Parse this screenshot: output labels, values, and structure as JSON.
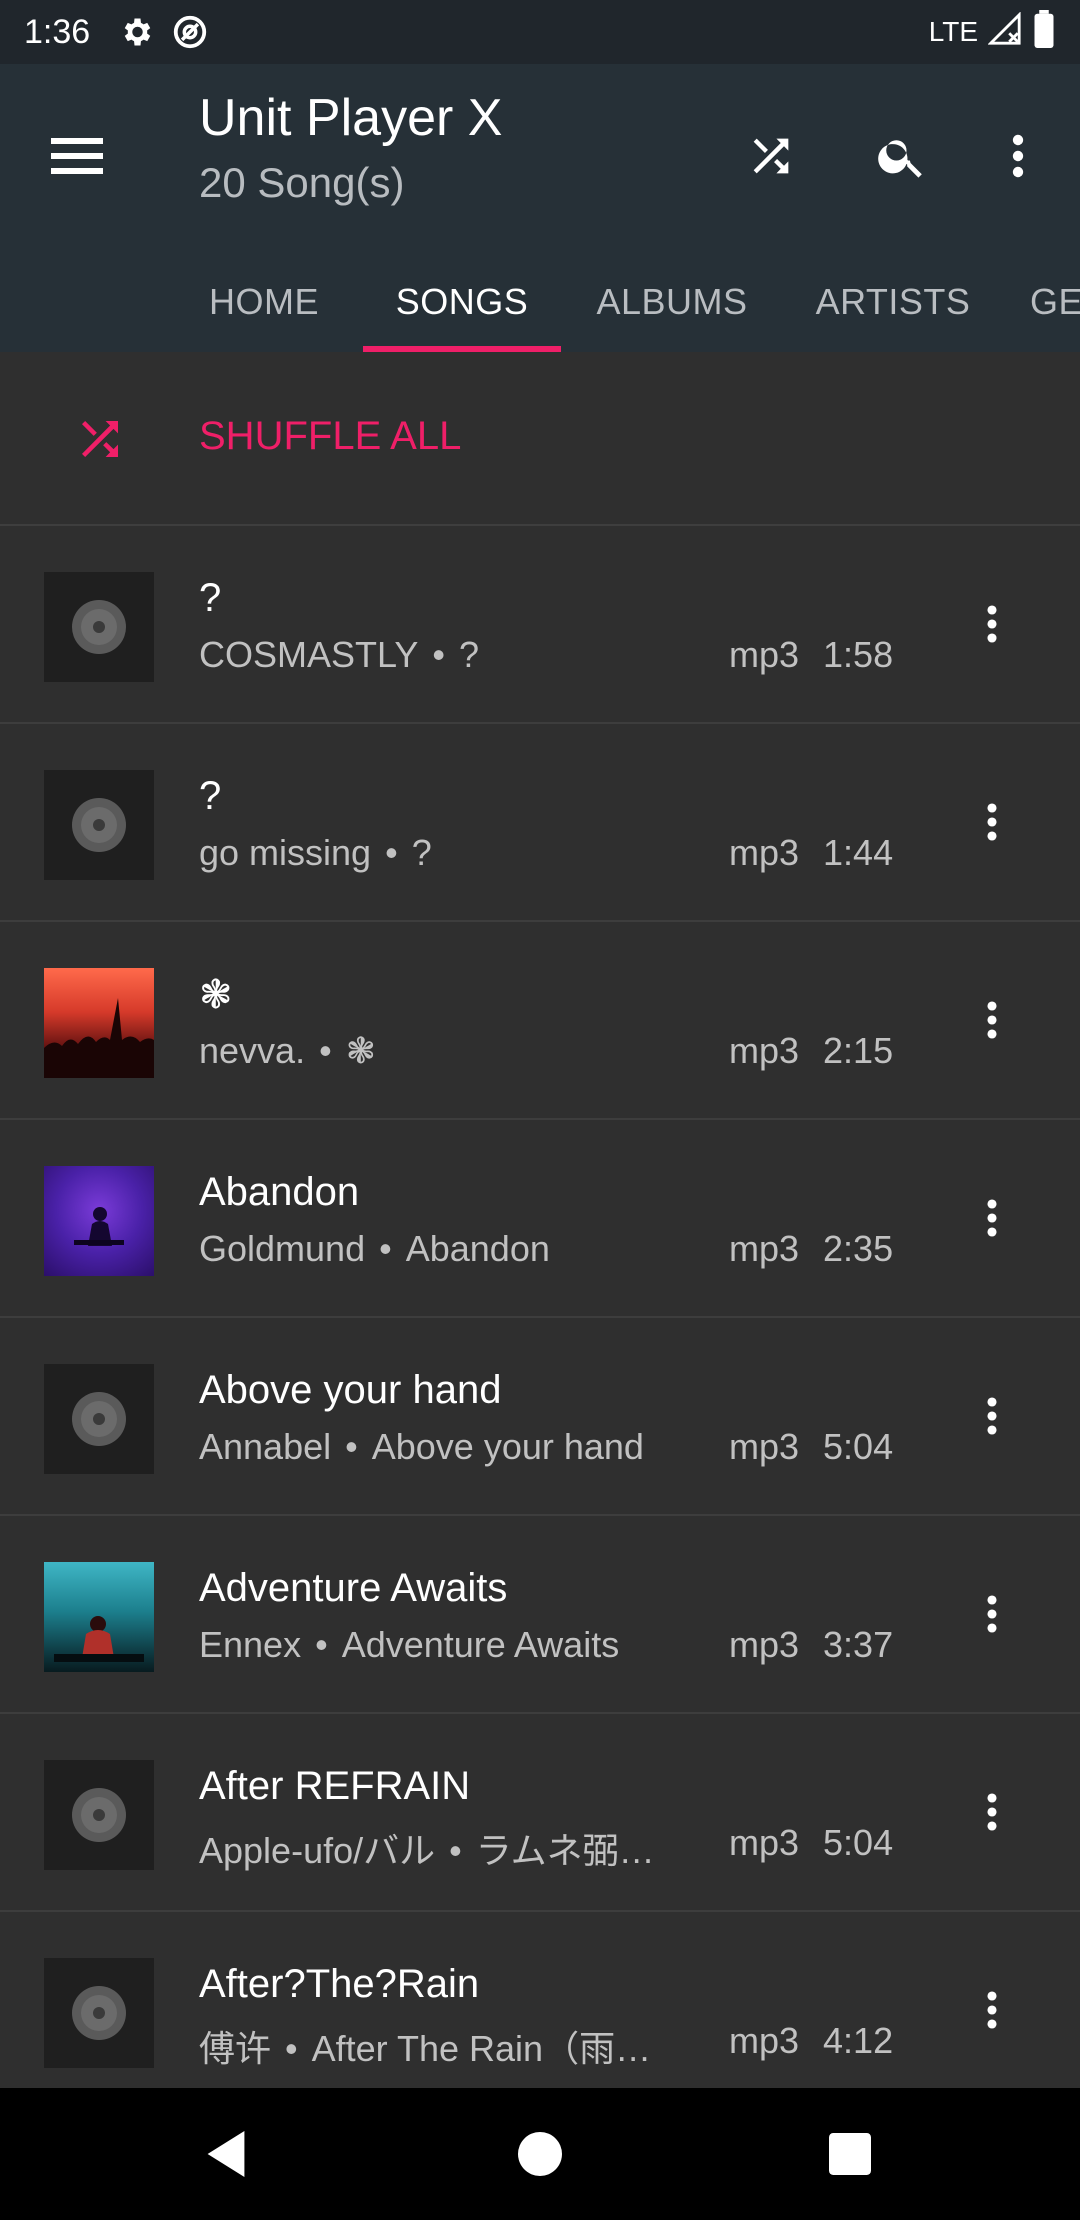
{
  "status_bar": {
    "time": "1:36",
    "network": "LTE",
    "icons": [
      "settings-icon",
      "no-disturb-icon",
      "signal-icon",
      "battery-icon"
    ]
  },
  "app_bar": {
    "title": "Unit Player X",
    "subtitle": "20 Song(s)",
    "actions": [
      "shuffle-icon",
      "search-icon",
      "more-vert-icon"
    ]
  },
  "tabs": [
    {
      "label": "HOME",
      "active": false
    },
    {
      "label": "SONGS",
      "active": true
    },
    {
      "label": "ALBUMS",
      "active": false
    },
    {
      "label": "ARTISTS",
      "active": false
    },
    {
      "label": "GE",
      "active": false
    }
  ],
  "shuffle_all": {
    "label": "SHUFFLE ALL"
  },
  "songs": [
    {
      "title": "?",
      "artist": "COSMASTLY",
      "album": "?",
      "format": "mp3",
      "duration": "1:58",
      "art": "default"
    },
    {
      "title": "?",
      "artist": "go missing",
      "album": "?",
      "format": "mp3",
      "duration": "1:44",
      "art": "default"
    },
    {
      "title": "❃",
      "artist": "nevva.",
      "album": "❃",
      "format": "mp3",
      "duration": "2:15",
      "art": "concert"
    },
    {
      "title": "Abandon",
      "artist": "Goldmund",
      "album": "Abandon",
      "format": "mp3",
      "duration": "2:35",
      "art": "purple"
    },
    {
      "title": "Above your hand",
      "artist": "Annabel",
      "album": "Above your hand",
      "format": "mp3",
      "duration": "5:04",
      "art": "default"
    },
    {
      "title": "Adventure Awaits",
      "artist": "Ennex",
      "album": "Adventure Awaits",
      "format": "mp3",
      "duration": "3:37",
      "art": "teal"
    },
    {
      "title": "After REFRAIN",
      "artist": "Apple-ufo/バル",
      "album": "ラムネ弼…",
      "format": "mp3",
      "duration": "5:04",
      "art": "default"
    },
    {
      "title": "After?The?Rain",
      "artist": "傅许",
      "album": "After The Rain（雨…",
      "format": "mp3",
      "duration": "4:12",
      "art": "default"
    }
  ],
  "separator": "•",
  "colors": {
    "accent": "#ef1f68",
    "app_bar": "#263037",
    "background": "#2f2f2f",
    "status_bar": "#20262c"
  },
  "nav_bar": [
    "back-icon",
    "home-icon",
    "recents-icon"
  ]
}
